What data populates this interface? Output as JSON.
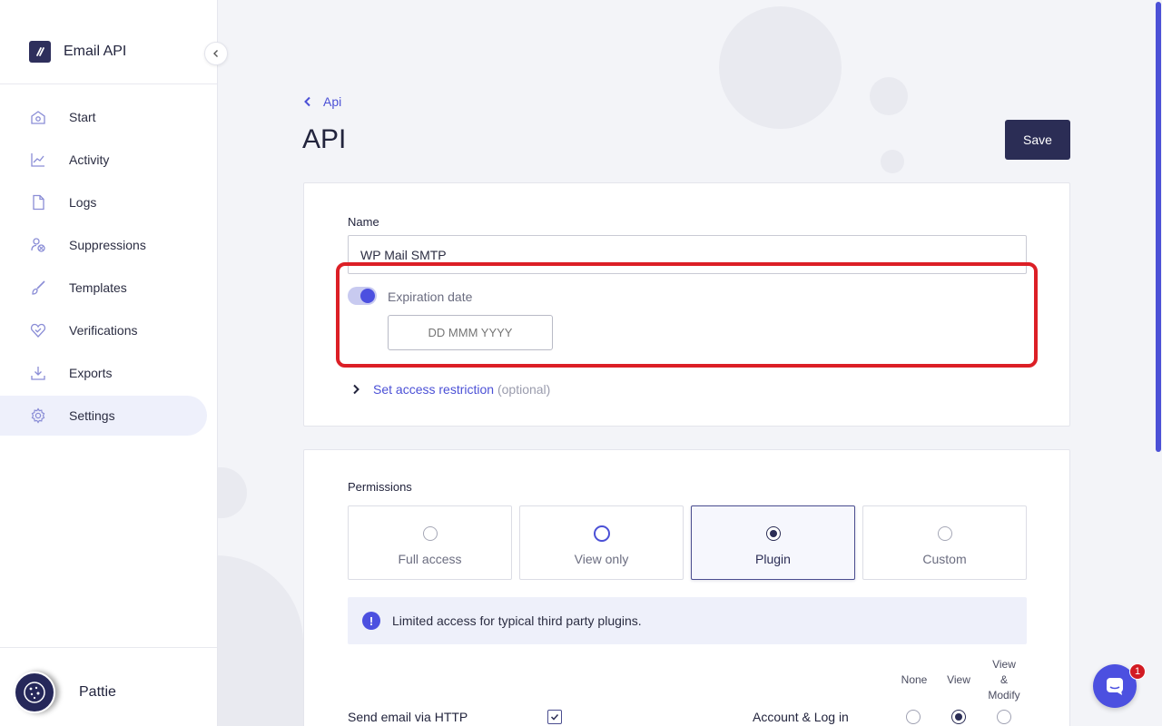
{
  "app": {
    "name": "Email API",
    "user_name": "Pattie"
  },
  "sidebar": {
    "items": [
      {
        "label": "Start",
        "icon": "home-icon"
      },
      {
        "label": "Activity",
        "icon": "chart-line-icon"
      },
      {
        "label": "Logs",
        "icon": "document-icon"
      },
      {
        "label": "Suppressions",
        "icon": "user-block-icon"
      },
      {
        "label": "Templates",
        "icon": "brush-icon"
      },
      {
        "label": "Verifications",
        "icon": "heart-check-icon"
      },
      {
        "label": "Exports",
        "icon": "download-icon"
      },
      {
        "label": "Settings",
        "icon": "gear-icon",
        "active": true
      }
    ]
  },
  "header": {
    "breadcrumb": "Api",
    "title": "API",
    "save_label": "Save"
  },
  "form": {
    "name_label": "Name",
    "name_value": "WP Mail SMTP",
    "expiration_label": "Expiration date",
    "expiration_enabled": true,
    "date_placeholder": "DD MMM YYYY",
    "restriction_link": "Set access restriction",
    "restriction_optional": "(optional)"
  },
  "permissions": {
    "title": "Permissions",
    "options": [
      {
        "label": "Full access",
        "state": "unchecked"
      },
      {
        "label": "View only",
        "state": "focused"
      },
      {
        "label": "Plugin",
        "state": "checked"
      },
      {
        "label": "Custom",
        "state": "unchecked"
      }
    ],
    "info": "Limited access for typical third party plugins.",
    "columns": {
      "none": "None",
      "view": "View",
      "view_modify_1": "View",
      "view_modify_2": "&",
      "view_modify_3": "Modify"
    },
    "rows": [
      {
        "label": "Send email via HTTP",
        "checked": true
      },
      {
        "label": "Account & Log in",
        "value": "View"
      }
    ]
  },
  "chat": {
    "badge_count": "1"
  },
  "colors": {
    "accent": "#4c50e0",
    "primary_dark": "#2b2d55",
    "highlight": "#dc1f26"
  }
}
